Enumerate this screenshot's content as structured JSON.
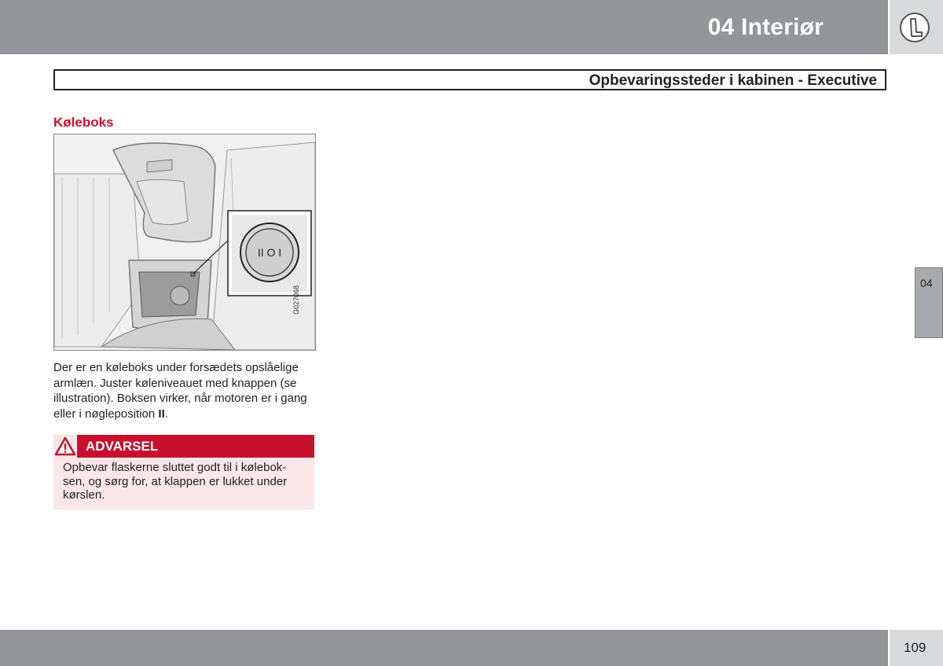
{
  "header": {
    "chapter_title": "04 Interiør",
    "chapter_icon": "seat-icon"
  },
  "section": {
    "title": "Opbevaringssteder i kabinen - Executive"
  },
  "content": {
    "subheading": "Køleboks",
    "figure_code": "G027068",
    "paragraph": {
      "text": "Der er en køleboks under forsædets opslåelige armlæn. Juster køleniveauet med knappen (se illustration). Boksen virker, når motoren er i gang eller i nøgleposition ",
      "bold_suffix": "II",
      "end": "."
    },
    "warning": {
      "label": "ADVARSEL",
      "text": "Opbevar flaskerne sluttet godt til i kølebok-sen, og sørg for, at klappen er lukket under kørslen.",
      "icon": "warning-triangle-icon"
    },
    "illustration": {
      "button_marks": "II O I"
    }
  },
  "side_tab": {
    "label": "04"
  },
  "footer": {
    "page_number": "109"
  },
  "colors": {
    "accent": "#c8102e",
    "header_gray": "#939598",
    "warning_bg": "#fbe6e9"
  }
}
